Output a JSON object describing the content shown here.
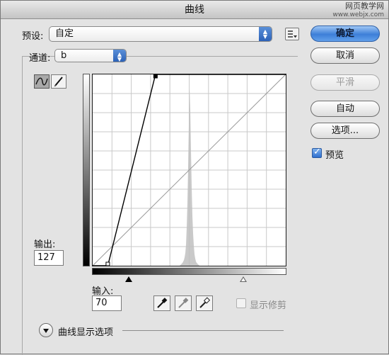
{
  "window": {
    "title": "曲线"
  },
  "watermark": {
    "line1": "网页教学网",
    "line2": "www.webjx.com"
  },
  "preset": {
    "label": "预设:",
    "value": "自定"
  },
  "channel": {
    "label": "通道:",
    "value": "b"
  },
  "buttons": {
    "ok": "确定",
    "cancel": "取消",
    "smooth": "平滑",
    "auto": "自动",
    "options": "选项..."
  },
  "preview": {
    "label": "预览",
    "checked": true
  },
  "output": {
    "label": "输出:",
    "value": "127"
  },
  "input": {
    "label": "输入:",
    "value": "70"
  },
  "show_clipping": {
    "label": "显示修剪",
    "checked": false,
    "enabled": false
  },
  "curve_display_options": {
    "label": "曲线显示选项"
  },
  "chart_data": {
    "type": "line",
    "xlim": [
      0,
      255
    ],
    "ylim": [
      0,
      255
    ],
    "grid": true,
    "grid_divisions": 10,
    "curve_points": [
      [
        0,
        0
      ],
      [
        20,
        0
      ],
      [
        83,
        255
      ],
      [
        255,
        255
      ]
    ],
    "baseline": [
      [
        0,
        0
      ],
      [
        255,
        255
      ]
    ],
    "histogram_peak_x": 128,
    "colors": {
      "curve": "#000000",
      "baseline": "#9a9a9a",
      "grid": "#c9c9c9",
      "histogram": "#c0c0c0"
    }
  }
}
